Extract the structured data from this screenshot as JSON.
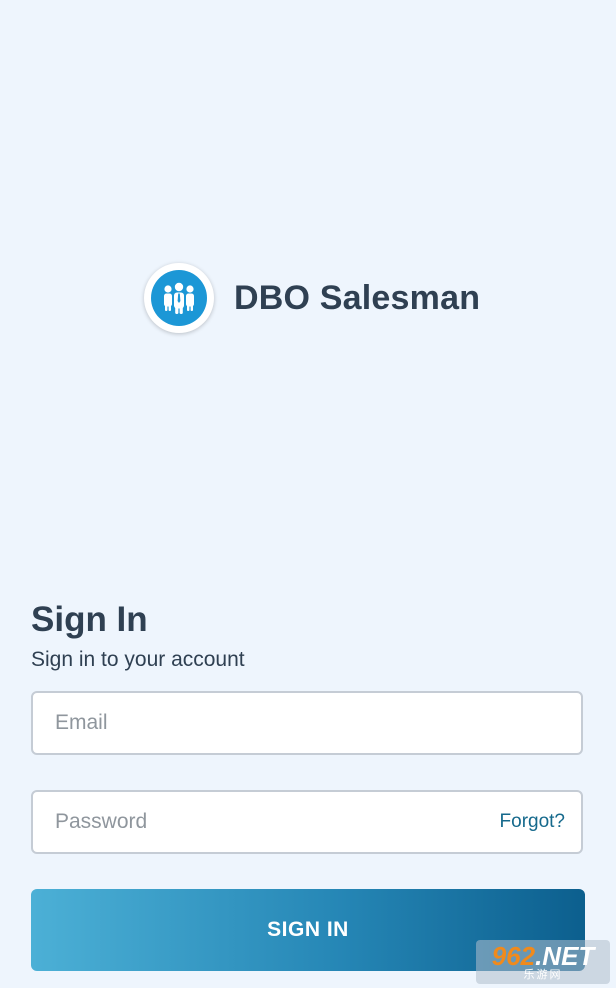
{
  "app": {
    "name": "DBO Salesman",
    "logo_icon": "people-group-icon",
    "accent_color": "#1c97d6"
  },
  "signin": {
    "title": "Sign In",
    "subtitle": "Sign in to your account",
    "email_placeholder": "Email",
    "email_value": "",
    "password_placeholder": "Password",
    "password_value": "",
    "forgot_label": "Forgot?",
    "button_label": "SIGN IN"
  },
  "watermark": {
    "digits": "962",
    "suffix": ".NET",
    "sub": "乐游网"
  }
}
